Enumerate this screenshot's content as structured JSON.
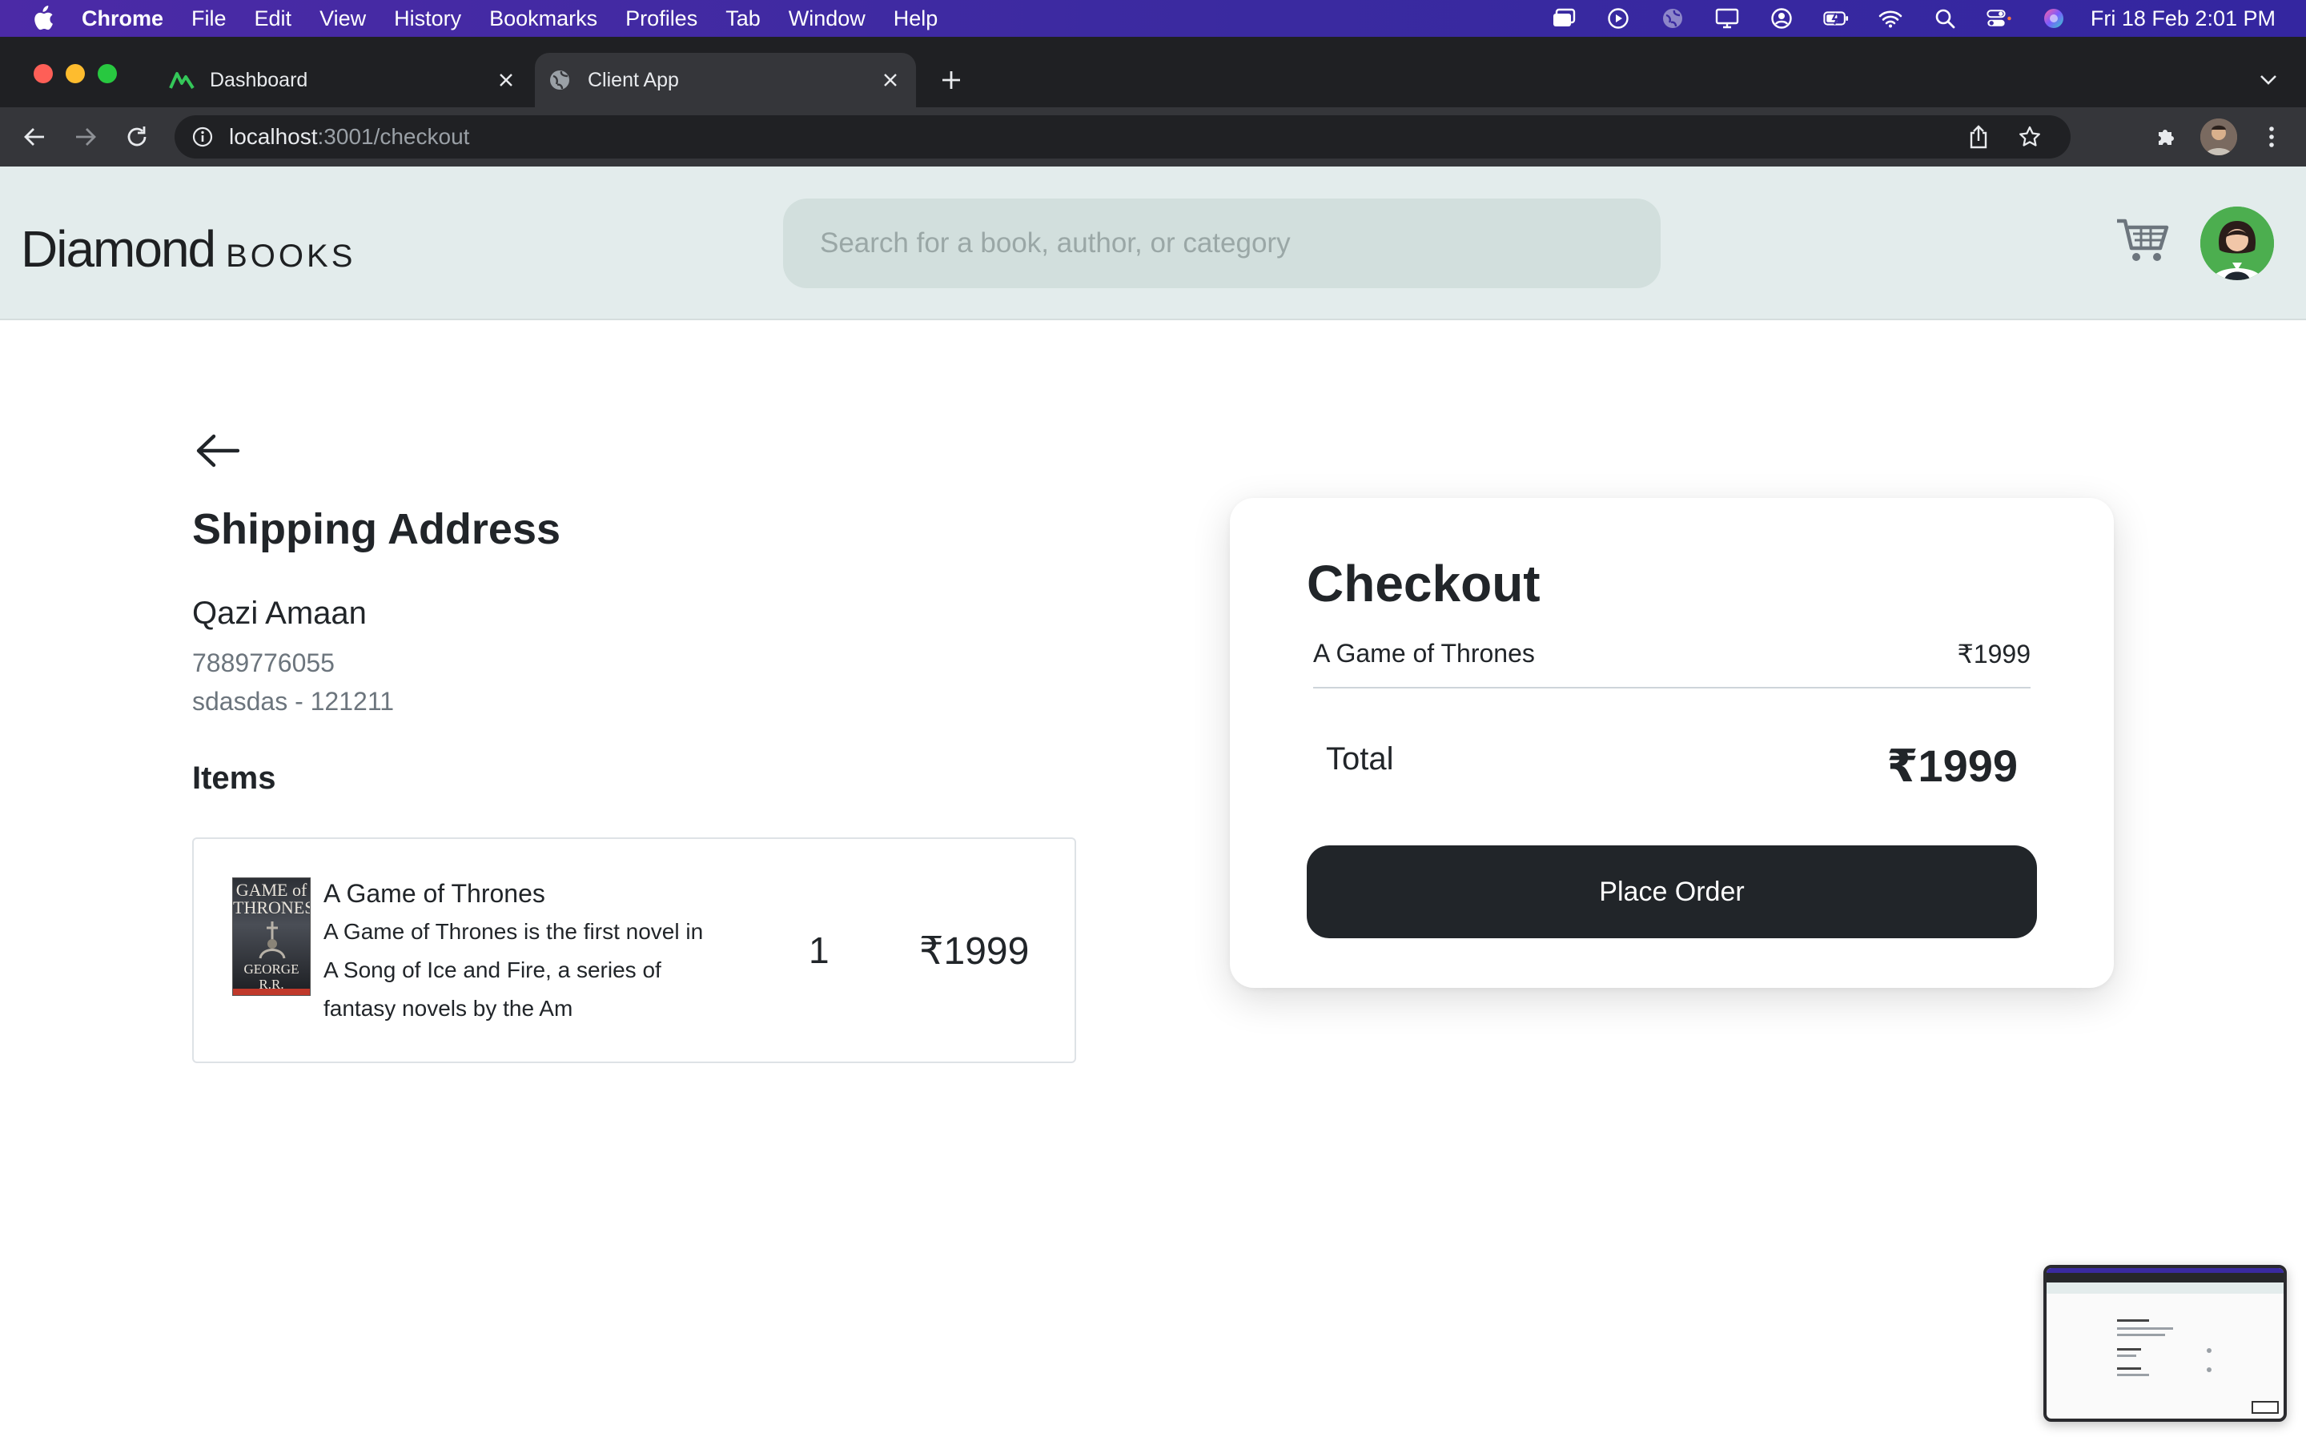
{
  "menubar": {
    "app_name": "Chrome",
    "items": [
      "File",
      "Edit",
      "View",
      "History",
      "Bookmarks",
      "Profiles",
      "Tab",
      "Window",
      "Help"
    ],
    "clock": "Fri 18 Feb  2:01 PM"
  },
  "browser": {
    "tabs": [
      {
        "title": "Dashboard",
        "active": false
      },
      {
        "title": "Client App",
        "active": true
      }
    ],
    "url_host": "localhost",
    "url_rest": ":3001/checkout"
  },
  "header": {
    "logo_main": "Diamond",
    "logo_sub": "BOOKS",
    "search_placeholder": "Search for a book, author, or category"
  },
  "shipping": {
    "heading": "Shipping Address",
    "name": "Qazi Amaan",
    "phone": "7889776055",
    "address": "sdasdas - 121211"
  },
  "items": {
    "heading": "Items",
    "list": [
      {
        "title": "A Game of Thrones",
        "description": "A Game of Thrones is the first novel in A Song of Ice and Fire, a series of fantasy novels by the Am",
        "quantity": "1",
        "price": "₹1999",
        "cover_title": "GAME of THRONES",
        "cover_author": "GEORGE R.R. MARTIN"
      }
    ]
  },
  "checkout": {
    "title": "Checkout",
    "line_items": [
      {
        "name": "A Game of Thrones",
        "price": "₹1999"
      }
    ],
    "total_label": "Total",
    "total_value": "₹1999",
    "button_label": "Place Order"
  },
  "colors": {
    "header_bg": "#e3ecec",
    "search_bg": "#d2dfdd",
    "button_dark": "#212529",
    "menubar": "#3a2aa0"
  }
}
